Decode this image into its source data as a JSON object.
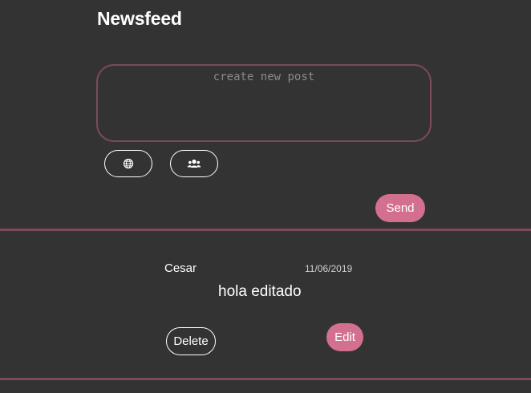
{
  "header": {
    "title": "Newsfeed"
  },
  "composer": {
    "placeholder": "create new post",
    "value": "",
    "privacy_buttons": [
      {
        "icon": "globe-icon",
        "name": "public"
      },
      {
        "icon": "users-icon",
        "name": "friends"
      }
    ],
    "send_label": "Send"
  },
  "posts": [
    {
      "author": "Cesar",
      "date": "11/06/2019",
      "content": "hola editado",
      "delete_label": "Delete",
      "edit_label": "Edit"
    }
  ],
  "colors": {
    "background": "#333333",
    "accent": "#d4708f",
    "border_accent": "#7d4a5a",
    "text": "#ffffff"
  }
}
